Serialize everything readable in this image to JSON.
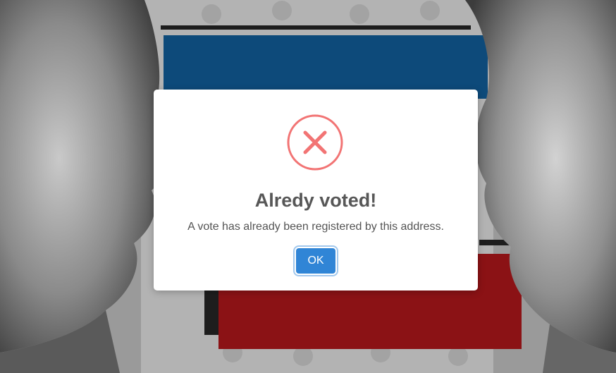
{
  "dialog": {
    "icon": "error-x-icon",
    "title": "Alredy voted!",
    "message": "A vote has already been registered by this address.",
    "ok_label": "OK"
  },
  "colors": {
    "icon_red": "#f27474",
    "button_blue": "#3085d6",
    "flag_blue": "#0d4a7a",
    "flag_red": "#8b1215"
  }
}
